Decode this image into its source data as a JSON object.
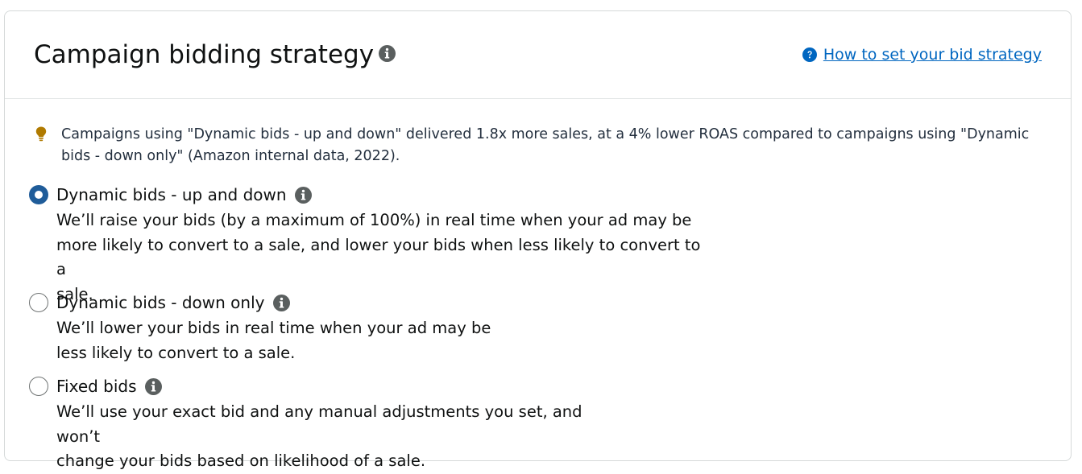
{
  "header": {
    "title": "Campaign bidding strategy",
    "help_link": "How to set your bid strategy"
  },
  "tip": {
    "text": "Campaigns using \"Dynamic bids - up and down\" delivered 1.8x more sales, at a 4% lower ROAS compared to campaigns using \"Dynamic bids - down only\" (Amazon internal data, 2022).",
    "icon": "lightbulb-icon"
  },
  "options": [
    {
      "label": "Dynamic bids - up and down",
      "selected": true,
      "description_lines": [
        "We’ll raise your bids (by a maximum of 100%) in real time when your ad may be",
        "more likely to convert to a sale, and lower your bids when less likely to convert to a",
        "sale."
      ]
    },
    {
      "label": "Dynamic bids - down only",
      "selected": false,
      "description_lines": [
        "We’ll lower your bids in real time when your ad may be",
        "less likely to convert to a sale."
      ]
    },
    {
      "label": "Fixed bids",
      "selected": false,
      "description_lines": [
        "We’ll use your exact bid and any manual adjustments you set, and won’t",
        "change your bids based on likelihood of a sale."
      ]
    }
  ],
  "colors": {
    "link": "#0066c0",
    "radio_selected": "#1f5c99",
    "info_icon": "#5a5f5f",
    "bulb": "#b07a00"
  }
}
